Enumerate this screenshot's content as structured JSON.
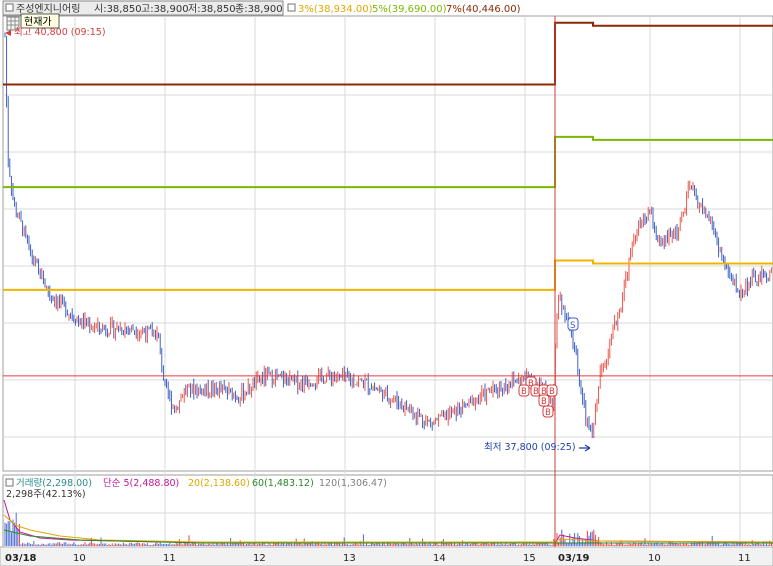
{
  "header": {
    "stock_name": "주성엔지니어링",
    "open_label": "시:38,850",
    "high_label": "고:38,900",
    "low_label": "저:38,850",
    "close_label": "종:38,900",
    "envelope_3": "3%(38,934.00)",
    "envelope_5": "5%(39,690.00)",
    "envelope_7": "7%(40,446.00)",
    "tooltip": "현재가"
  },
  "annotations": {
    "high_marker": "최고 40,800 (09:15)",
    "low_marker": "최저 37,800 (09:25)",
    "sell_signal": "S",
    "buy_signal": "B"
  },
  "volume_header": {
    "volume_label": "거래량(2,298.00)",
    "ma5": "단순 5(2,488.80)",
    "ma20": "20(2,138.60)",
    "ma60": "60(1,483.12)",
    "ma120": "120(1,306.47)",
    "volume_value": "2,298주(42.13%)"
  },
  "x_labels": [
    "03/18",
    "10",
    "11",
    "12",
    "13",
    "14",
    "15",
    "03/19",
    "10",
    "11"
  ],
  "colors": {
    "up": "#e8463a",
    "down": "#2a52be",
    "env3": "#f0b400",
    "env5": "#7ab800",
    "env7": "#8b2a00",
    "base": "#e33b3b",
    "grid": "#d9d9d9",
    "vol_up": "#e8463a",
    "vol_down": "#4a6cd4"
  },
  "chart_data": {
    "type": "candlestick",
    "levels": {
      "day1_env7": 40446,
      "day2_env7": 40900,
      "day1_env5": 39690,
      "day2_env5": 40060,
      "day1_env3": 38934,
      "day2_env3": 39150,
      "base_line": 38300,
      "high": 40800,
      "low": 37800
    }
  }
}
